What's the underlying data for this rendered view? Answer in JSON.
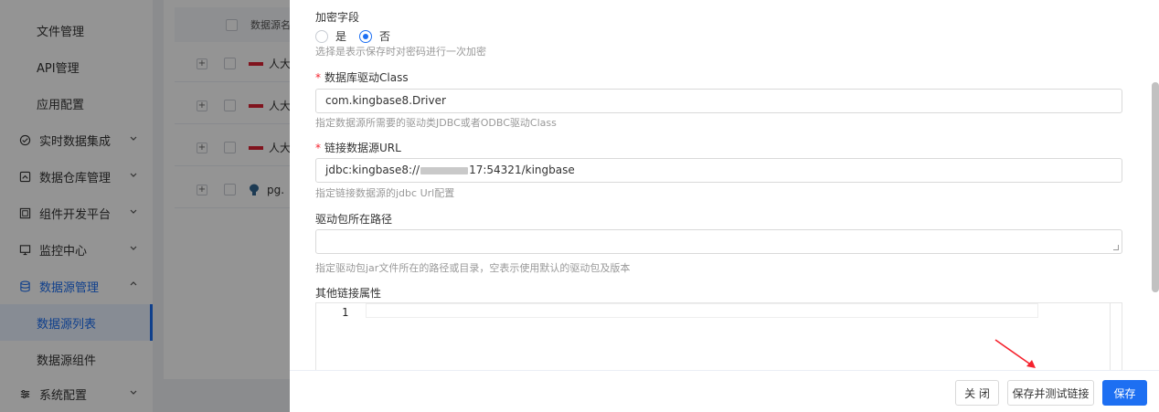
{
  "sidebar": {
    "items": [
      {
        "label": "文件管理",
        "type": "sub"
      },
      {
        "label": "API管理",
        "type": "sub"
      },
      {
        "label": "应用配置",
        "type": "sub"
      },
      {
        "label": "实时数据集成",
        "type": "group",
        "icon": "realtime-icon"
      },
      {
        "label": "数据仓库管理",
        "type": "group",
        "icon": "warehouse-icon"
      },
      {
        "label": "组件开发平台",
        "type": "group",
        "icon": "component-icon"
      },
      {
        "label": "监控中心",
        "type": "group",
        "icon": "monitor-icon"
      },
      {
        "label": "数据源管理",
        "type": "group-open",
        "icon": "database-icon"
      },
      {
        "label": "数据源列表",
        "type": "sub-active"
      },
      {
        "label": "数据源组件",
        "type": "sub"
      },
      {
        "label": "系统配置",
        "type": "group",
        "icon": "settings-icon"
      }
    ]
  },
  "table": {
    "header": "数据源名",
    "rows": [
      {
        "expand": "+",
        "text": "人大"
      },
      {
        "expand": "+",
        "text": "人大"
      },
      {
        "expand": "+",
        "text": "人大"
      },
      {
        "expand": "+",
        "text": "pg."
      }
    ]
  },
  "form": {
    "encrypt": {
      "label": "加密字段",
      "option_yes": "是",
      "option_no": "否",
      "selected": "否",
      "hint": "选择是表示保存时对密码进行一次加密"
    },
    "driver_class": {
      "required": "*",
      "label": "数据库驱动Class",
      "value": "com.kingbase8.Driver",
      "hint": "指定数据源所需要的驱动类JDBC或者ODBC驱动Class"
    },
    "url": {
      "required": "*",
      "label": "链接数据源URL",
      "value_prefix": "jdbc:kingbase8://",
      "value_suffix": "17:54321/kingbase",
      "hint": "指定链接数据源的jdbc Url配置"
    },
    "driver_path": {
      "label": "驱动包所在路径",
      "value": "",
      "hint": "指定驱动包jar文件所在的路径或目录，空表示使用默认的驱动包及版本"
    },
    "other_props": {
      "label": "其他链接属性",
      "line_number": "1"
    }
  },
  "footer": {
    "close_label": "关 闭",
    "save_test_label": "保存并测试链接",
    "save_label": "保存"
  },
  "colors": {
    "primary": "#1d6ff2",
    "required": "#f5222d",
    "arrow": "#f5222d"
  }
}
